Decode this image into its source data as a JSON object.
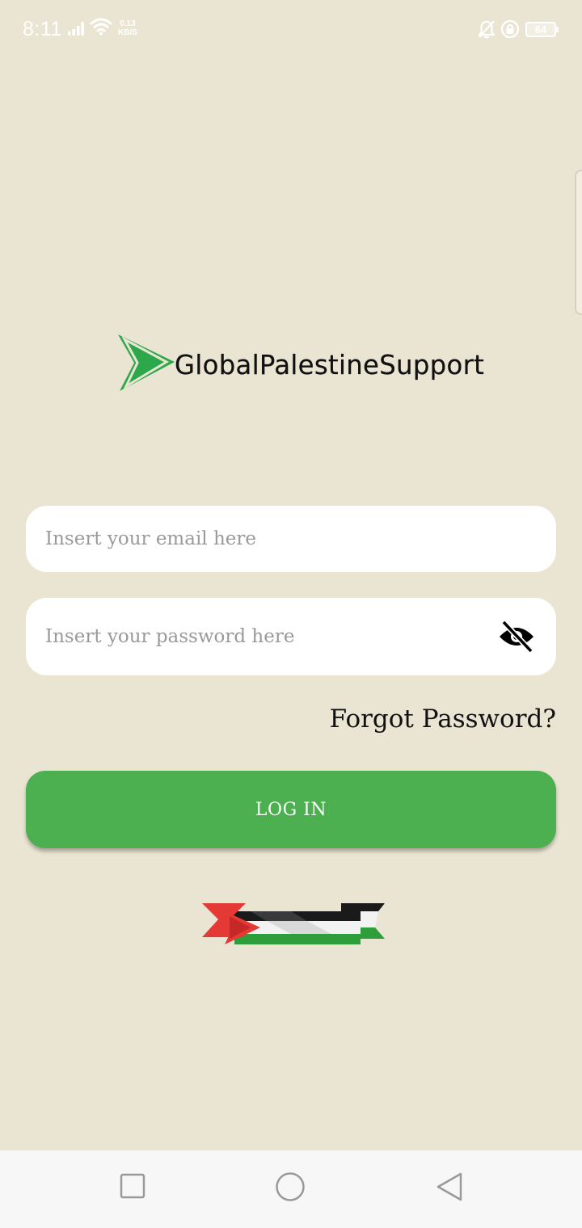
{
  "status_bar": {
    "time": "8:11",
    "speed_value": "0.13",
    "speed_unit": "KB/S",
    "battery": "64",
    "icons": [
      "signal-icon",
      "wifi-icon",
      "bell-off-icon",
      "lock-icon",
      "battery-icon"
    ]
  },
  "logo": {
    "text": "GlobalPalestineSupport",
    "icon": "play-arrow-logo-icon",
    "color": "#2CA84A"
  },
  "form": {
    "email_placeholder": "Insert your email here",
    "email_value": "",
    "password_placeholder": "Insert your password here",
    "password_value": "",
    "password_toggle_icon": "eye-off-icon",
    "forgot_label": "Forgot Password?",
    "login_label": "LOG IN"
  },
  "flag": {
    "icon": "palestine-flag-icon",
    "colors": [
      "#E53935",
      "#1A1A1A",
      "#F2F2F2",
      "#2E9E3A"
    ]
  },
  "nav_bar": {
    "icons": [
      "recents-square-icon",
      "home-circle-icon",
      "back-triangle-icon"
    ]
  },
  "colors": {
    "background": "#EAE5D3",
    "accent": "#4CAF50",
    "field": "#FFFFFF"
  }
}
